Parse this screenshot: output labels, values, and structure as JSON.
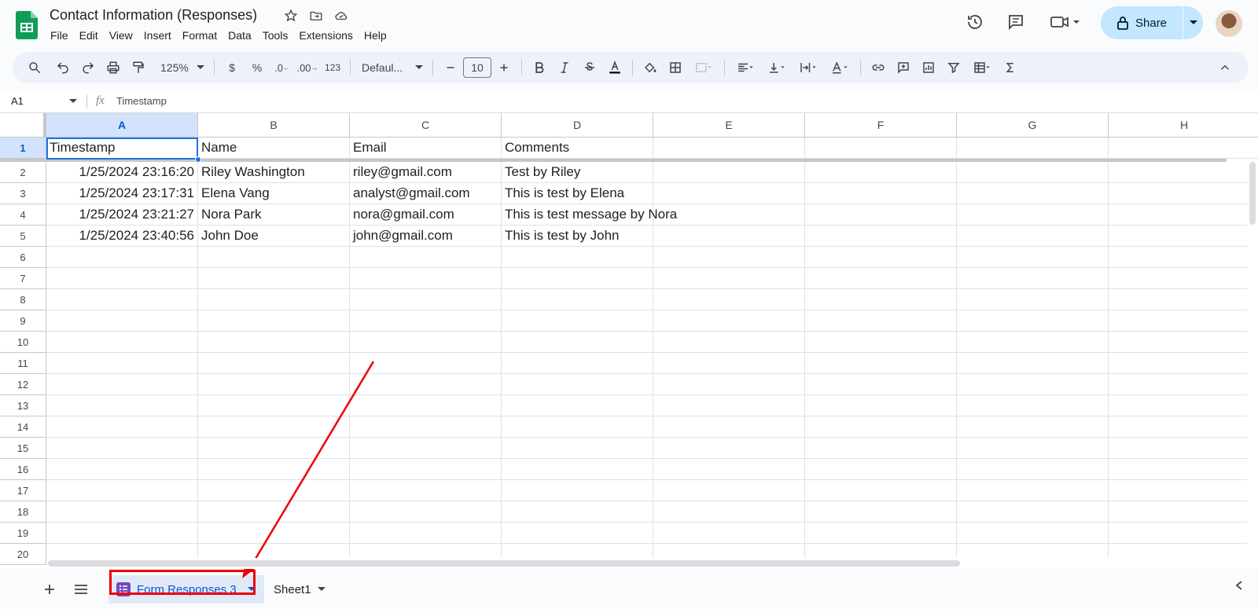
{
  "app": {
    "title": "Contact Information (Responses)"
  },
  "menu": [
    "File",
    "Edit",
    "View",
    "Insert",
    "Format",
    "Data",
    "Tools",
    "Extensions",
    "Help"
  ],
  "share": {
    "label": "Share"
  },
  "toolbar": {
    "zoom": "125%",
    "currency": "$",
    "percent": "%",
    "dec_less": ".0",
    "dec_more": ".00",
    "format_123": "123",
    "font": "Defaul...",
    "font_size": "10"
  },
  "formula_bar": {
    "cell_ref": "A1",
    "fx": "fx",
    "value": "Timestamp"
  },
  "columns": [
    "A",
    "B",
    "C",
    "D",
    "E",
    "F",
    "G",
    "H"
  ],
  "rows": [
    "1",
    "2",
    "3",
    "4",
    "5",
    "6",
    "7",
    "8",
    "9",
    "10",
    "11",
    "12",
    "13",
    "14",
    "15",
    "16",
    "17",
    "18",
    "19",
    "20"
  ],
  "cells": [
    [
      "Timestamp",
      "Name",
      "Email",
      "Comments"
    ],
    [
      "1/25/2024 23:16:20",
      "Riley Washington",
      "riley@gmail.com",
      "Test by Riley"
    ],
    [
      "1/25/2024 23:17:31",
      "Elena Vang",
      "analyst@gmail.com",
      "This is test by Elena"
    ],
    [
      "1/25/2024 23:21:27",
      "Nora Park",
      "nora@gmail.com",
      "This is test message by Nora"
    ],
    [
      "1/25/2024 23:40:56",
      "John Doe",
      "john@gmail.com",
      "This is test by John"
    ]
  ],
  "tabs": {
    "active": "Form Responses 3",
    "other": "Sheet1"
  },
  "colors": {
    "accent": "#0b57d0",
    "share_bg": "#c2e7ff",
    "highlight": "#ee0000",
    "sheets_green": "#0f9d58"
  },
  "icons": [
    "sheets-logo",
    "star-icon",
    "move-folder-icon",
    "cloud-saved-icon",
    "history-icon",
    "comment-icon",
    "video-icon",
    "lock-icon",
    "search-icon",
    "undo-icon",
    "redo-icon",
    "print-icon",
    "paint-format-icon",
    "bold-icon",
    "italic-icon",
    "strikethrough-icon",
    "text-color-icon",
    "fill-color-icon",
    "borders-icon",
    "merge-icon",
    "align-icon",
    "valign-icon",
    "wrap-icon",
    "rotate-icon",
    "link-icon",
    "add-comment-icon",
    "chart-icon",
    "filter-icon",
    "table-icon",
    "sum-icon",
    "collapse-icon",
    "add-sheet-icon",
    "all-sheets-icon",
    "form-icon"
  ]
}
